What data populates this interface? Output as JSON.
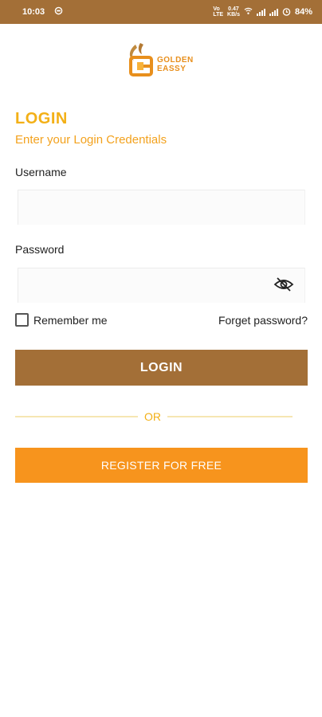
{
  "status_bar": {
    "time": "10:03",
    "network_speed": "0.47",
    "network_unit": "KB/s",
    "battery": "84%"
  },
  "logo": {
    "line1": "GOLDEN",
    "line2": "EASSY"
  },
  "login": {
    "title": "LOGIN",
    "subtitle": "Enter your Login Credentials",
    "username_label": "Username",
    "username_value": "",
    "password_label": "Password",
    "password_value": "",
    "remember_label": "Remember me",
    "remember_checked": false,
    "forgot_label": "Forget password?",
    "login_button": "LOGIN",
    "or_text": "OR",
    "register_button": "REGISTER FOR FREE"
  },
  "colors": {
    "brand_brown": "#a36f37",
    "accent_orange": "#f7941d",
    "title_gold": "#f3b017"
  },
  "icons": [
    "clock-icon",
    "network-type-icon",
    "wifi-icon",
    "signal-icon",
    "alarm-icon",
    "logo-icon",
    "eye-slash-icon",
    "checkbox-icon"
  ]
}
